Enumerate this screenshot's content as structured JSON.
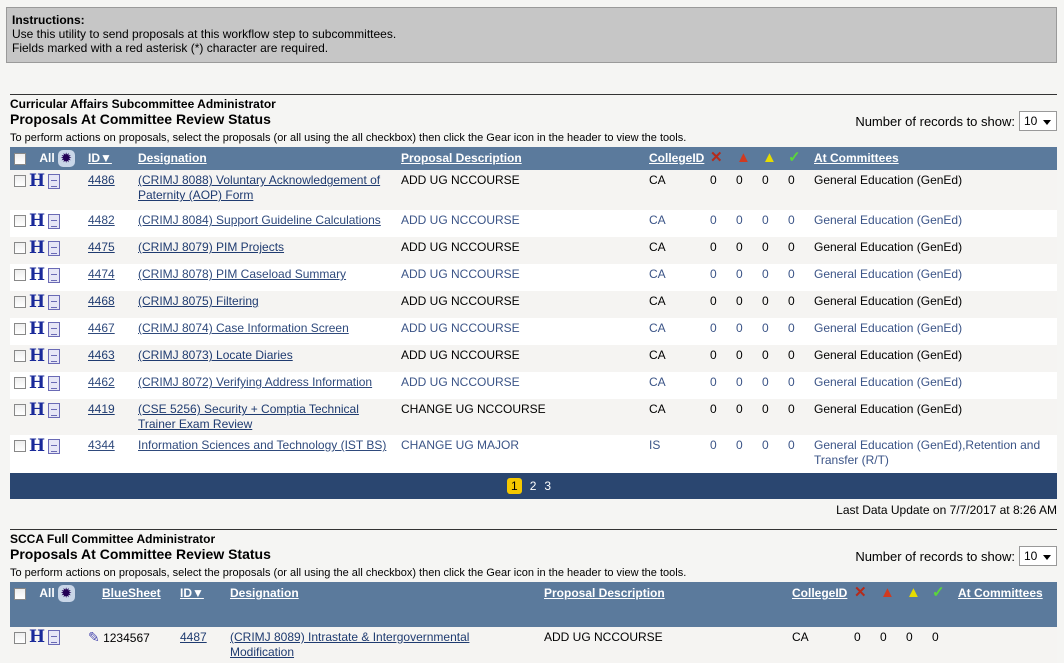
{
  "instructions": {
    "heading": "Instructions:",
    "lines": [
      "Use this utility to send proposals at this workflow step to subcommittees.",
      "Fields marked with a red asterisk (*) character are required."
    ]
  },
  "icons": {
    "reject": "x-icon",
    "error": "red-warning-icon",
    "warning": "yellow-warning-icon",
    "approved": "check-icon",
    "gear": "gear-icon",
    "history": "h-icon",
    "document": "document-icon",
    "edit": "pencil-icon"
  },
  "colors": {
    "header": "#5b7a9c",
    "pager": "#2a4670",
    "current_page": "#f5c800"
  },
  "section1": {
    "admin": "Curricular Affairs Subcommittee Administrator",
    "title": "Proposals At Committee Review Status",
    "records_label": "Number of records to show:",
    "records_value": "10",
    "note": "To perform actions on proposals, select the proposals (or all using the all checkbox) then click the Gear icon in the header to view the tools.",
    "headers": {
      "all": "All",
      "id": "ID▼",
      "designation": "Designation",
      "description": "Proposal Description",
      "college": "CollegeID",
      "committees": "At Committees"
    },
    "rows": [
      {
        "id": "4486",
        "designation": "(CRIMJ 8088) Voluntary Acknowledgement of Paternity (AOP) Form",
        "description": "ADD UG NCCOURSE",
        "college": "CA",
        "c1": "0",
        "c2": "0",
        "c3": "0",
        "c4": "0",
        "committees": "General Education (GenEd)"
      },
      {
        "id": "4482",
        "designation": "(CRIMJ 8084) Support Guideline Calculations",
        "description": "ADD UG NCCOURSE",
        "college": "CA",
        "c1": "0",
        "c2": "0",
        "c3": "0",
        "c4": "0",
        "committees": "General Education (GenEd)"
      },
      {
        "id": "4475",
        "designation": "(CRIMJ 8079) PIM Projects",
        "description": "ADD UG NCCOURSE",
        "college": "CA",
        "c1": "0",
        "c2": "0",
        "c3": "0",
        "c4": "0",
        "committees": "General Education (GenEd)"
      },
      {
        "id": "4474",
        "designation": "(CRIMJ 8078) PIM Caseload Summary",
        "description": "ADD UG NCCOURSE",
        "college": "CA",
        "c1": "0",
        "c2": "0",
        "c3": "0",
        "c4": "0",
        "committees": "General Education (GenEd)"
      },
      {
        "id": "4468",
        "designation": "(CRIMJ 8075) Filtering",
        "description": "ADD UG NCCOURSE",
        "college": "CA",
        "c1": "0",
        "c2": "0",
        "c3": "0",
        "c4": "0",
        "committees": "General Education (GenEd)"
      },
      {
        "id": "4467",
        "designation": "(CRIMJ 8074) Case Information Screen",
        "description": "ADD UG NCCOURSE",
        "college": "CA",
        "c1": "0",
        "c2": "0",
        "c3": "0",
        "c4": "0",
        "committees": "General Education (GenEd)"
      },
      {
        "id": "4463",
        "designation": "(CRIMJ 8073) Locate Diaries",
        "description": "ADD UG NCCOURSE",
        "college": "CA",
        "c1": "0",
        "c2": "0",
        "c3": "0",
        "c4": "0",
        "committees": "General Education (GenEd)"
      },
      {
        "id": "4462",
        "designation": "(CRIMJ 8072) Verifying Address Information",
        "description": "ADD UG NCCOURSE",
        "college": "CA",
        "c1": "0",
        "c2": "0",
        "c3": "0",
        "c4": "0",
        "committees": "General Education (GenEd)"
      },
      {
        "id": "4419",
        "designation": "(CSE 5256) Security + Comptia Technical Trainer Exam Review",
        "description": "CHANGE UG NCCOURSE",
        "college": "CA",
        "c1": "0",
        "c2": "0",
        "c3": "0",
        "c4": "0",
        "committees": "General Education (GenEd)"
      },
      {
        "id": "4344",
        "designation": "Information Sciences and Technology (IST BS)",
        "description": "CHANGE UG MAJOR",
        "college": "IS",
        "c1": "0",
        "c2": "0",
        "c3": "0",
        "c4": "0",
        "committees": "General Education (GenEd),Retention and Transfer (R/T)"
      }
    ],
    "pages": [
      "1",
      "2",
      "3"
    ],
    "current_page": "1",
    "last_update": "Last Data Update on 7/7/2017 at 8:26 AM"
  },
  "section2": {
    "admin": "SCCA Full Committee Administrator",
    "title": "Proposals At Committee Review Status",
    "records_label": "Number of records to show:",
    "records_value": "10",
    "note": "To perform actions on proposals, select the proposals (or all using the all checkbox) then click the Gear icon in the header to view the tools.",
    "headers": {
      "all": "All",
      "bluesheet": "BlueSheet",
      "id": "ID▼",
      "designation": "Designation",
      "description": "Proposal Description",
      "college": "CollegeID",
      "committees": "At Committees"
    },
    "rows": [
      {
        "bluesheet": "1234567",
        "id": "4487",
        "designation": "(CRIMJ 8089) Intrastate & Intergovernmental Modification",
        "description": "ADD UG NCCOURSE",
        "college": "CA",
        "c1": "0",
        "c2": "0",
        "c3": "0",
        "c4": "0",
        "committees": ""
      }
    ]
  }
}
